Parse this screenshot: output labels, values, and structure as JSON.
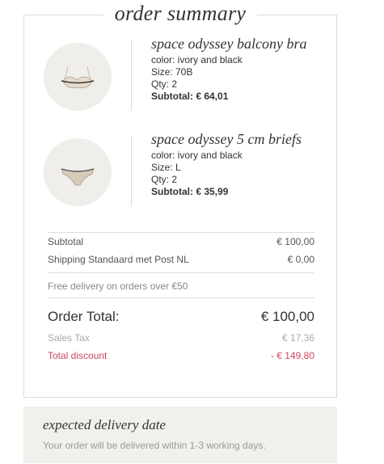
{
  "summary": {
    "title": "order summary",
    "items": [
      {
        "name": "space odyssey balcony bra",
        "color": "color: ivory and black",
        "size": "Size: 70B",
        "qty": "Qty: 2",
        "subtotal": "Subtotal: € 64,01",
        "icon": "bra-icon"
      },
      {
        "name": "space odyssey 5 cm briefs",
        "color": "color: ivory and black",
        "size": "Size: L",
        "qty": "Qty: 2",
        "subtotal": "Subtotal: € 35,99",
        "icon": "briefs-icon"
      }
    ],
    "totals": {
      "subtotal_label": "Subtotal",
      "subtotal_value": "€ 100,00",
      "shipping_label": "Shipping Standaard met Post NL",
      "shipping_value": "€ 0,00",
      "free_delivery_note": "Free delivery on orders over €50",
      "order_total_label": "Order Total:",
      "order_total_value": "€ 100,00",
      "tax_label": "Sales Tax",
      "tax_value": "€ 17,36",
      "discount_label": "Total discount",
      "discount_value": "- € 149,80"
    }
  },
  "delivery": {
    "title": "expected delivery date",
    "text": "Your order will be delivered within 1-3 working days."
  },
  "colors": {
    "border": "#dcdcdc",
    "thumb_bg": "#efeeea",
    "discount": "#c94a5c",
    "delivery_bg": "#f1f0ec",
    "muted_text": "#9a9a9a"
  }
}
